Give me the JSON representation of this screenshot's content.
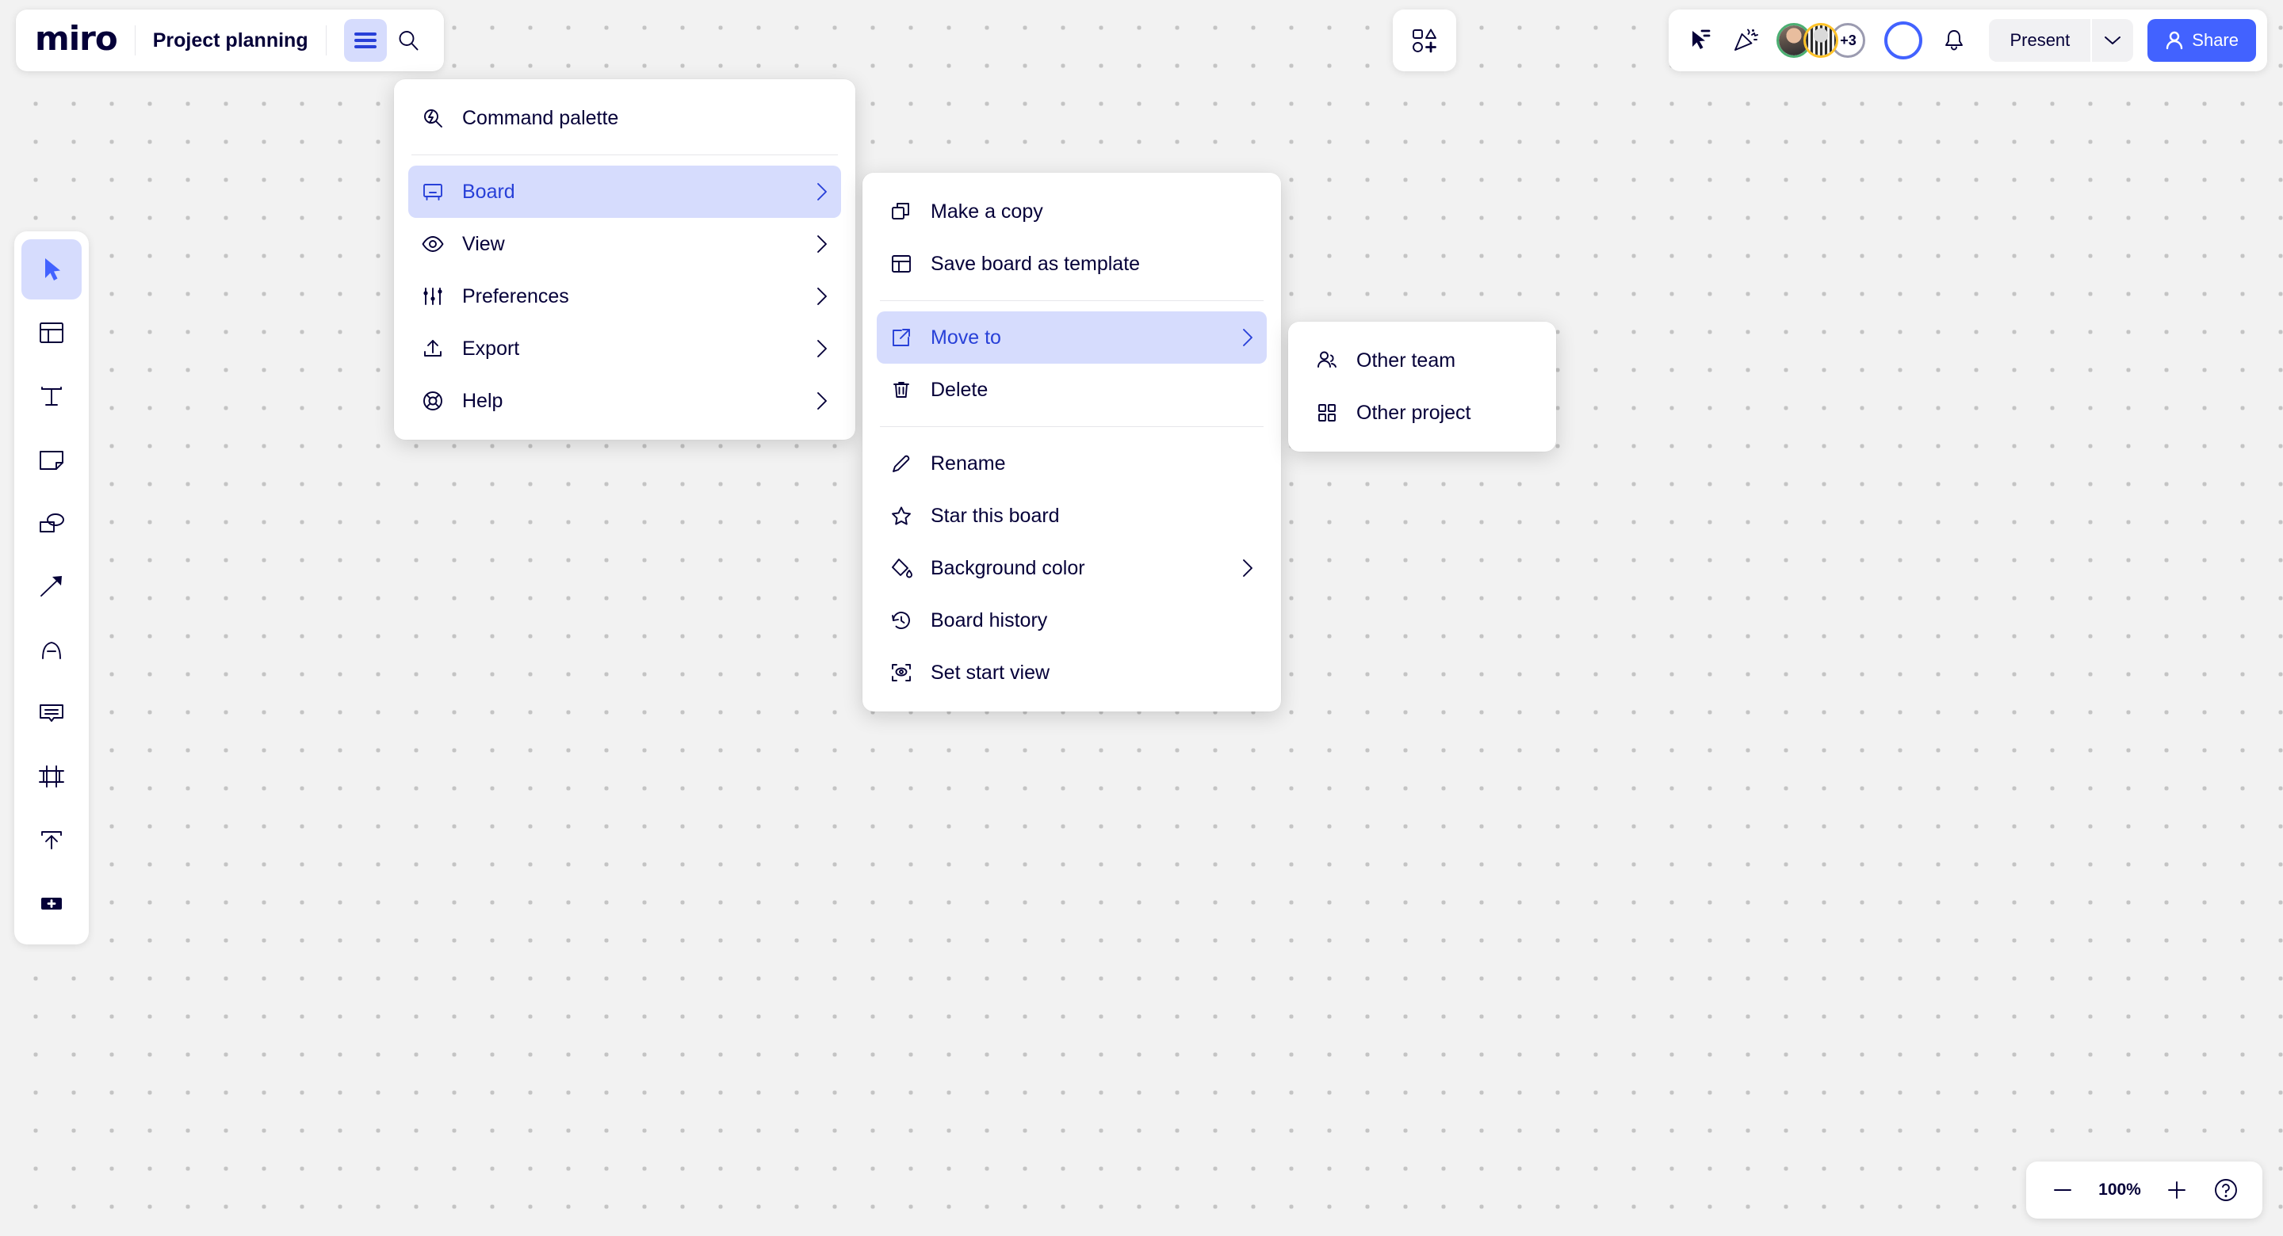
{
  "app": {
    "logo": "miro",
    "board_title": "Project planning"
  },
  "header": {
    "menu_button": "hamburger-menu",
    "search_button": "search",
    "apps_button": "apps-and-shapes"
  },
  "collab": {
    "cursor_chat_label": "cursor-chat",
    "reactions_label": "reactions",
    "avatars": [
      {
        "name": "collaborator-1",
        "ring": "#4caf72"
      },
      {
        "name": "collaborator-2",
        "ring": "#ffc329"
      }
    ],
    "overflow_count": "+3",
    "overflow_ring": "#9b9bb0",
    "me_ring": "#4262ff",
    "notifications_label": "notifications"
  },
  "actions": {
    "present_label": "Present",
    "present_caret": "chevron-down",
    "share_label": "Share"
  },
  "toolbar": {
    "items": [
      {
        "name": "select-tool",
        "active": true
      },
      {
        "name": "templates-tool",
        "active": false
      },
      {
        "name": "text-tool",
        "active": false
      },
      {
        "name": "sticky-note-tool",
        "active": false
      },
      {
        "name": "shapes-tool",
        "active": false
      },
      {
        "name": "connector-tool",
        "active": false
      },
      {
        "name": "pen-tool",
        "active": false
      },
      {
        "name": "comment-tool",
        "active": false
      },
      {
        "name": "frame-tool",
        "active": false
      },
      {
        "name": "upload-tool",
        "active": false
      },
      {
        "name": "more-apps-tool",
        "active": false
      }
    ]
  },
  "menu_main": {
    "command_palette": "Command palette",
    "items": [
      {
        "label": "Board",
        "icon": "board-icon",
        "selected": true,
        "has_submenu": true
      },
      {
        "label": "View",
        "icon": "eye-icon",
        "selected": false,
        "has_submenu": true
      },
      {
        "label": "Preferences",
        "icon": "sliders-icon",
        "selected": false,
        "has_submenu": true
      },
      {
        "label": "Export",
        "icon": "export-icon",
        "selected": false,
        "has_submenu": true
      },
      {
        "label": "Help",
        "icon": "lifebuoy-icon",
        "selected": false,
        "has_submenu": true
      }
    ]
  },
  "menu_board": {
    "group1": [
      {
        "label": "Make a copy",
        "icon": "copy-icon",
        "selected": false,
        "has_submenu": false
      },
      {
        "label": "Save board as template",
        "icon": "template-icon",
        "selected": false,
        "has_submenu": false
      }
    ],
    "group2": [
      {
        "label": "Move to",
        "icon": "external-link-icon",
        "selected": true,
        "has_submenu": true
      },
      {
        "label": "Delete",
        "icon": "trash-icon",
        "selected": false,
        "has_submenu": false
      }
    ],
    "group3": [
      {
        "label": "Rename",
        "icon": "pencil-icon",
        "selected": false,
        "has_submenu": false
      },
      {
        "label": "Star this board",
        "icon": "star-icon",
        "selected": false,
        "has_submenu": false
      },
      {
        "label": "Background color",
        "icon": "paint-bucket-icon",
        "selected": false,
        "has_submenu": true
      },
      {
        "label": "Board history",
        "icon": "history-icon",
        "selected": false,
        "has_submenu": false
      },
      {
        "label": "Set start view",
        "icon": "start-view-icon",
        "selected": false,
        "has_submenu": false
      }
    ]
  },
  "menu_moveto": {
    "items": [
      {
        "label": "Other team",
        "icon": "people-icon",
        "selected": false,
        "has_submenu": false
      },
      {
        "label": "Other project",
        "icon": "grid-icon",
        "selected": false,
        "has_submenu": false
      }
    ]
  },
  "zoom": {
    "minus_label": "zoom-out",
    "level": "100%",
    "plus_label": "zoom-in",
    "help_label": "help"
  },
  "colors": {
    "accent": "#4262ff",
    "accent_text": "#2840d8",
    "highlight_bg": "#d6dcfd",
    "ink": "#050038",
    "canvas": "#f2f2f2"
  }
}
